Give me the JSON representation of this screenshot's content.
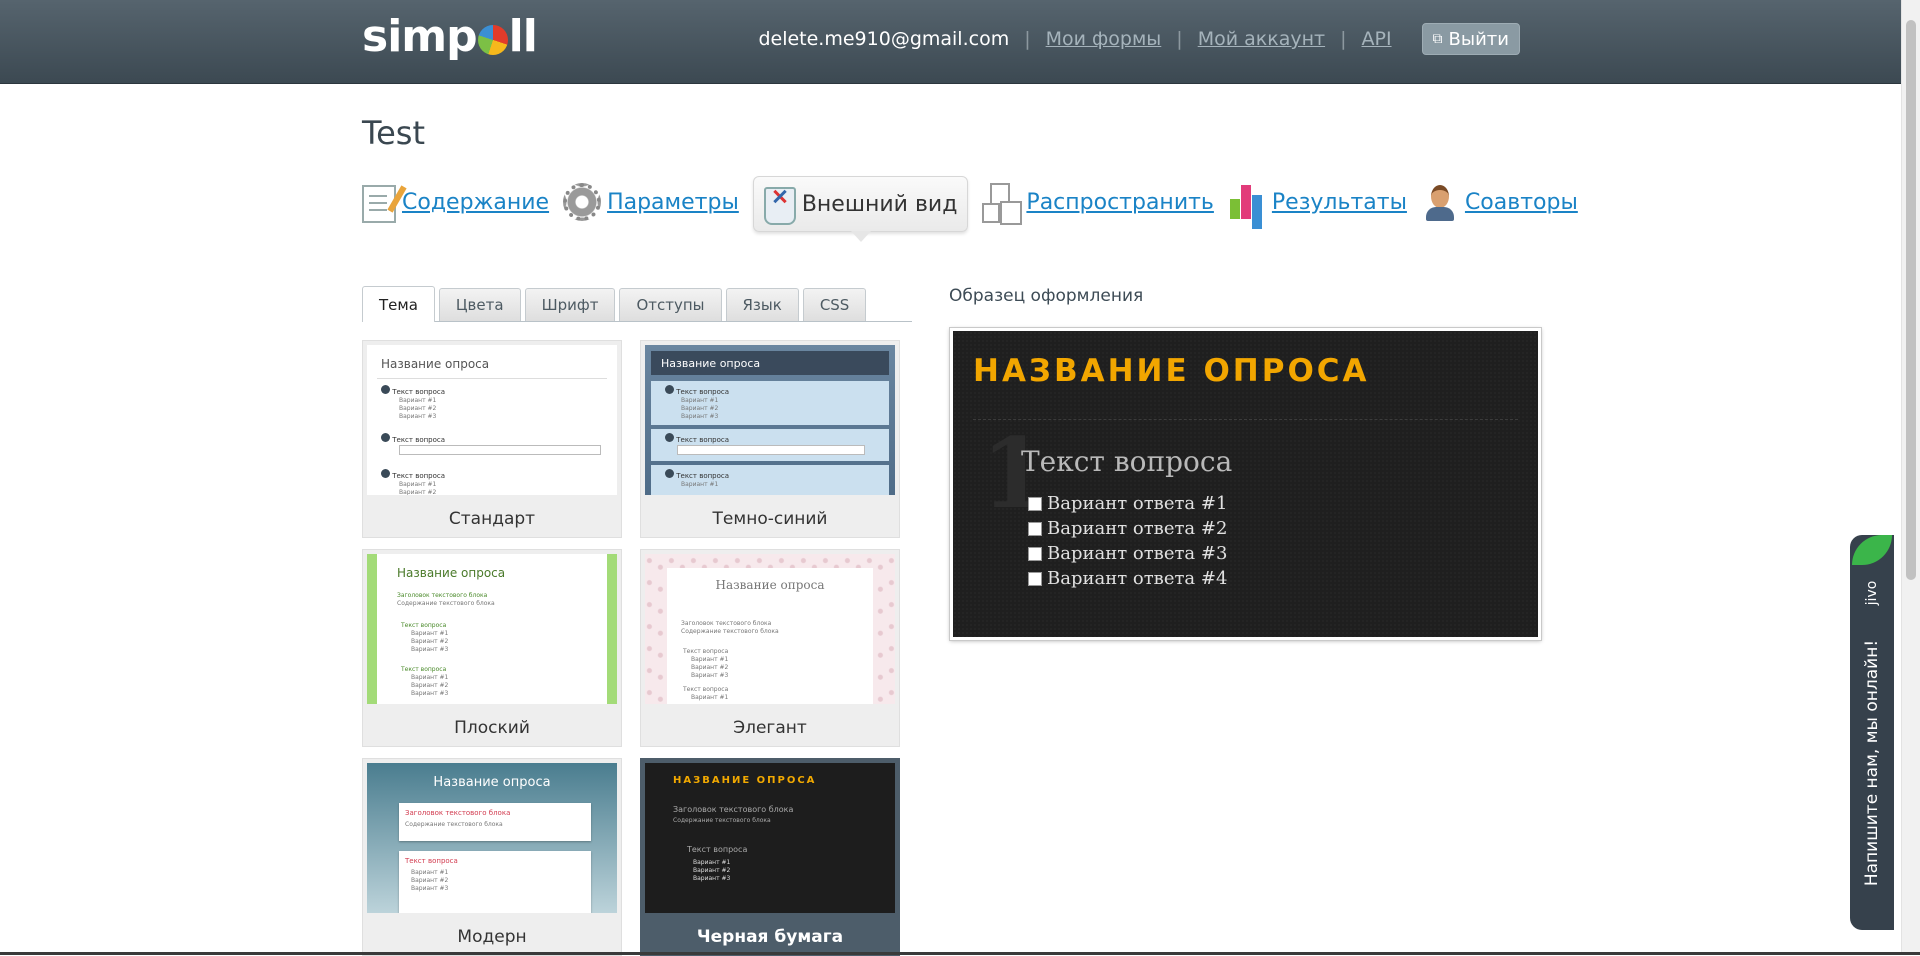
{
  "header": {
    "logo_left": "simp",
    "logo_right": "ll",
    "email": "delete.me910@gmail.com",
    "links": [
      "Мои формы",
      "Мой аккаунт",
      "API"
    ],
    "separator": "|",
    "logout_label": "Выйти"
  },
  "page": {
    "title": "Test"
  },
  "main_nav": {
    "items": [
      {
        "label": "Содержание",
        "icon": "pencil-document-icon"
      },
      {
        "label": "Параметры",
        "icon": "gear-icon"
      },
      {
        "label": "Внешний вид",
        "icon": "brush-cup-icon",
        "active": true
      },
      {
        "label": "Распространить",
        "icon": "share-documents-icon"
      },
      {
        "label": "Результаты",
        "icon": "bar-chart-icon"
      },
      {
        "label": "Соавторы",
        "icon": "user-icon"
      }
    ]
  },
  "sub_tabs": {
    "items": [
      "Тема",
      "Цвета",
      "Шрифт",
      "Отступы",
      "Язык",
      "CSS"
    ],
    "active": "Тема"
  },
  "themes": {
    "items": [
      {
        "name": "Стандарт",
        "thumb_title": "Название опроса"
      },
      {
        "name": "Темно-синий",
        "thumb_title": "Название опроса"
      },
      {
        "name": "Плоский",
        "thumb_title": "Название опроса"
      },
      {
        "name": "Элегант",
        "thumb_title": "Название опроса"
      },
      {
        "name": "Модерн",
        "thumb_title": "Название опроса"
      },
      {
        "name": "Черная бумага",
        "thumb_title": "НАЗВАНИЕ ОПРОСА",
        "selected": true
      }
    ],
    "thumb_text": {
      "question": "Текст вопроса",
      "option1": "Вариант #1",
      "option2": "Вариант #2",
      "option3": "Вариант #3",
      "block_title": "Заголовок текстового блока",
      "block_content": "Содержание текстового блока"
    }
  },
  "preview": {
    "label": "Образец оформления",
    "title": "НАЗВАНИЕ  ОПРОСА",
    "number": "1",
    "question": "Текст вопроса",
    "options": [
      "Вариант ответа #1",
      "Вариант ответа #2",
      "Вариант ответа #3",
      "Вариант ответа #4"
    ]
  },
  "jivo": {
    "brand": "jivo",
    "message": "Напишите нам, мы онлайн!"
  },
  "colors": {
    "link": "#1a83c6",
    "header_bg": "#4a5760",
    "preview_title": "#f2a600",
    "selected_theme": "#4d5d6a",
    "jivo_bg": "#36414c",
    "jivo_accent": "#3bb54a"
  }
}
